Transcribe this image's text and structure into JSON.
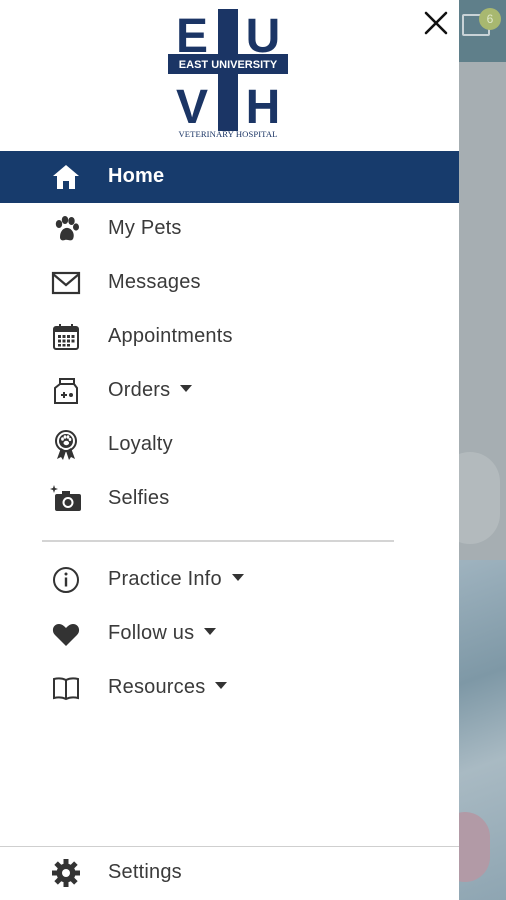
{
  "background": {
    "badge_count": "6"
  },
  "logo": {
    "top_left": "E",
    "top_right": "U",
    "bottom_left": "V",
    "bottom_right": "H",
    "band_text": "EAST UNIVERSITY",
    "caption": "VETERINARY HOSPITAL"
  },
  "colors": {
    "brand_navy": "#173b6c",
    "text": "#3a3a3a",
    "icon": "#333333"
  },
  "menu": {
    "home": {
      "label": "Home",
      "icon": "home-icon",
      "active": true
    },
    "my_pets": {
      "label": "My Pets",
      "icon": "paw-icon"
    },
    "messages": {
      "label": "Messages",
      "icon": "envelope-icon"
    },
    "appointments": {
      "label": "Appointments",
      "icon": "calendar-icon"
    },
    "orders": {
      "label": "Orders",
      "icon": "pet-food-bag-icon",
      "has_dropdown": true
    },
    "loyalty": {
      "label": "Loyalty",
      "icon": "paw-ribbon-badge-icon"
    },
    "selfies": {
      "label": "Selfies",
      "icon": "camera-icon"
    },
    "practice_info": {
      "label": "Practice Info",
      "icon": "info-icon",
      "has_dropdown": true
    },
    "follow_us": {
      "label": "Follow us",
      "icon": "heart-icon",
      "has_dropdown": true
    },
    "resources": {
      "label": "Resources",
      "icon": "book-icon",
      "has_dropdown": true
    }
  },
  "footer": {
    "settings": {
      "label": "Settings",
      "icon": "gear-icon"
    }
  }
}
